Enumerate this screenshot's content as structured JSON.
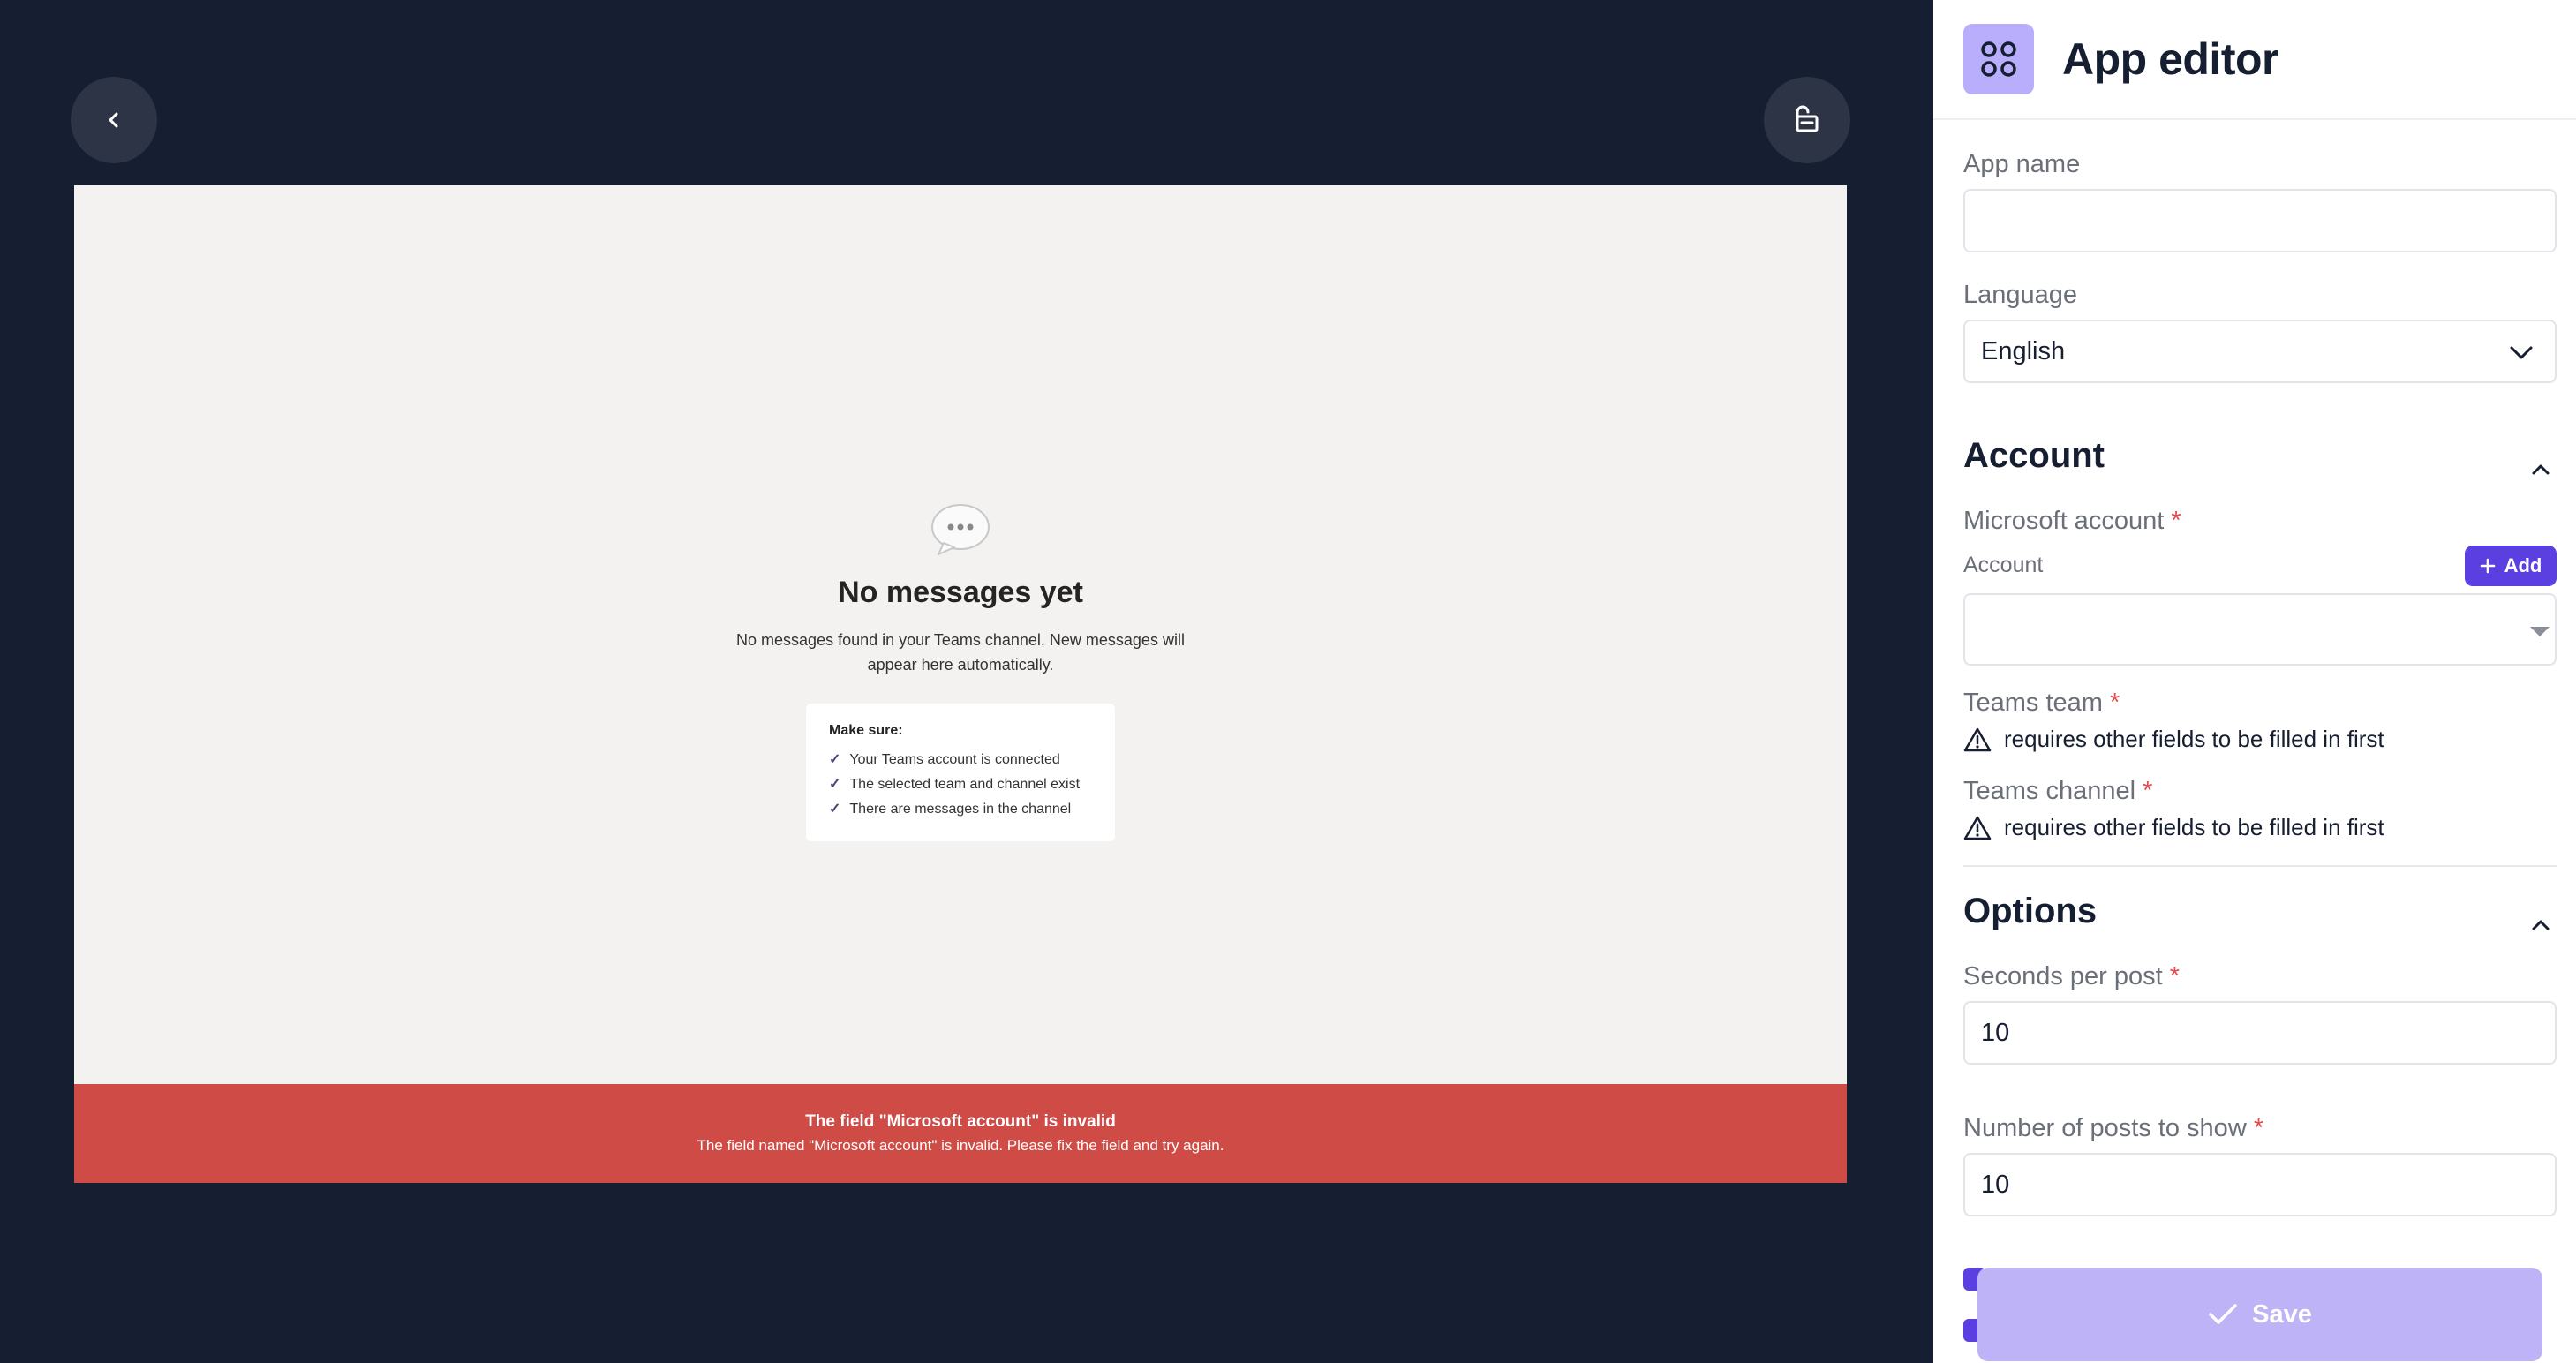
{
  "icons": {
    "back": "chevron-left-icon",
    "unlock": "unlock-icon",
    "app": "app-grid-icon",
    "chat": "speech-bubble-icon",
    "select": "chevron-down-icon",
    "collapse": "chevron-up-icon",
    "warning": "warning-triangle-icon",
    "add": "plus-icon",
    "save": "check-icon"
  },
  "colors": {
    "background": "#161e31",
    "accent": "#5b3fe0",
    "save": "#bfb3f7",
    "error": "#cf4b45"
  },
  "preview": {
    "empty_title": "No messages yet",
    "empty_desc": "No messages found in your Teams channel. New messages will appear here automatically.",
    "tips_title": "Make sure:",
    "tips": [
      "Your Teams account is connected",
      "The selected team and channel exist",
      "There are messages in the channel"
    ],
    "error_title": "The field \"Microsoft account\" is invalid",
    "error_msg": "The field named \"Microsoft account\" is invalid. Please fix the field and try again."
  },
  "panel": {
    "title": "App editor",
    "app_name_label": "App name",
    "app_name_value": "",
    "language_label": "Language",
    "language_value": "English",
    "account_section": "Account",
    "microsoft_account_label": "Microsoft account",
    "account_sub_label": "Account",
    "add_label": "Add",
    "teams_team_label": "Teams team",
    "teams_channel_label": "Teams channel",
    "requires_text": "requires other fields to be filled in first",
    "options_section": "Options",
    "seconds_label": "Seconds per post",
    "seconds_value": "10",
    "posts_label": "Number of posts to show",
    "posts_value": "10",
    "save_label": "Save",
    "required_mark": "*"
  }
}
